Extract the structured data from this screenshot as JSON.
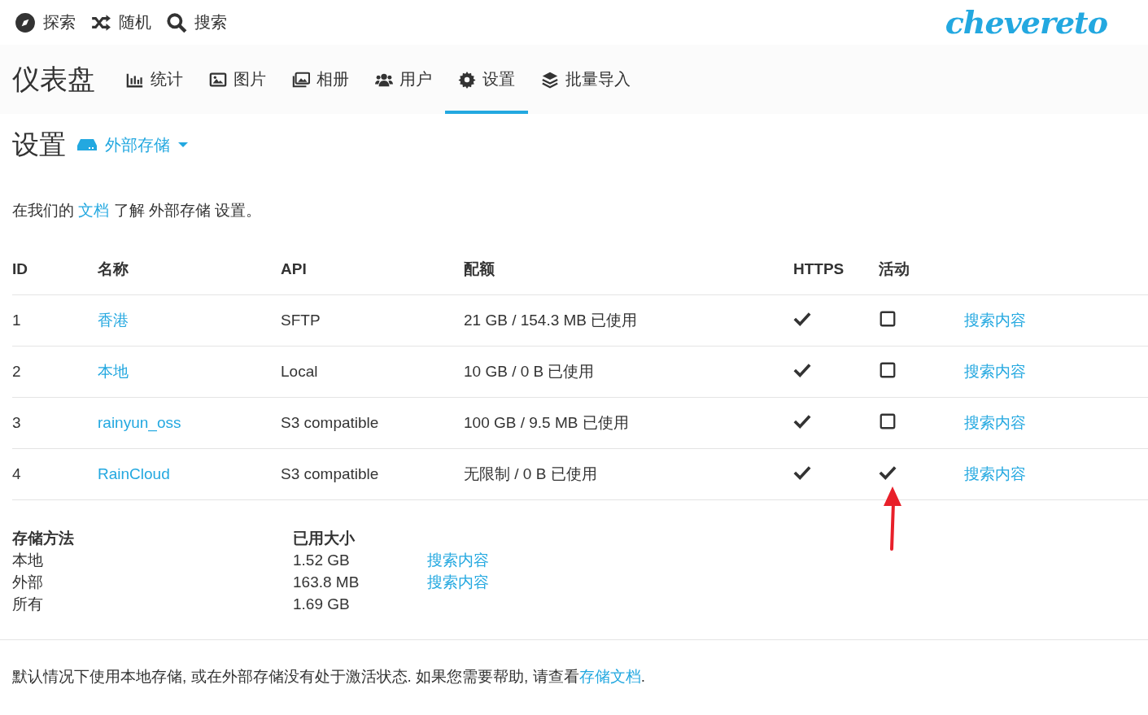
{
  "top_nav": [
    {
      "kind": "explore",
      "label": "探索"
    },
    {
      "kind": "random",
      "label": "随机"
    },
    {
      "kind": "search",
      "label": "搜索"
    }
  ],
  "logo": "chevereto",
  "dashboard": {
    "title": "仪表盘",
    "tabs": [
      {
        "kind": "stats",
        "label": "统计",
        "selected": false
      },
      {
        "kind": "images",
        "label": "图片",
        "selected": false
      },
      {
        "kind": "albums",
        "label": "相册",
        "selected": false
      },
      {
        "kind": "users",
        "label": "用户",
        "selected": false
      },
      {
        "kind": "settings",
        "label": "设置",
        "selected": true
      },
      {
        "kind": "import",
        "label": "批量导入",
        "selected": false
      }
    ]
  },
  "settings": {
    "title": "设置",
    "section_dropdown": "外部存储"
  },
  "intro": {
    "before": "在我们的 ",
    "link": "文档",
    "after": " 了解 外部存储 设置。"
  },
  "table": {
    "columns": [
      "ID",
      "名称",
      "API",
      "配额",
      "HTTPS",
      "活动"
    ],
    "rows": [
      {
        "id": "1",
        "name": "香港",
        "api": "SFTP",
        "quota": "21 GB / 154.3 MB 已使用",
        "https": true,
        "active": false,
        "action": "搜索内容"
      },
      {
        "id": "2",
        "name": "本地",
        "api": "Local",
        "quota": "10 GB / 0 B 已使用",
        "https": true,
        "active": false,
        "action": "搜索内容"
      },
      {
        "id": "3",
        "name": "rainyun_oss",
        "api": "S3 compatible",
        "quota": "100 GB / 9.5 MB 已使用",
        "https": true,
        "active": false,
        "action": "搜索内容"
      },
      {
        "id": "4",
        "name": "RainCloud",
        "api": "S3 compatible",
        "quota": "无限制 / 0 B 已使用",
        "https": true,
        "active": true,
        "action": "搜索内容"
      }
    ]
  },
  "summary": {
    "columns": [
      "存储方法",
      "已用大小"
    ],
    "rows": [
      {
        "method": "本地",
        "size": "1.52 GB",
        "action": "搜索内容"
      },
      {
        "method": "外部",
        "size": "163.8 MB",
        "action": "搜索内容"
      },
      {
        "method": "所有",
        "size": "1.69 GB"
      }
    ]
  },
  "footer": {
    "text": "默认情况下使用本地存储, 或在外部存储没有处于激活状态. 如果您需要帮助, 请查看",
    "link": "存储文档",
    "after": "."
  }
}
